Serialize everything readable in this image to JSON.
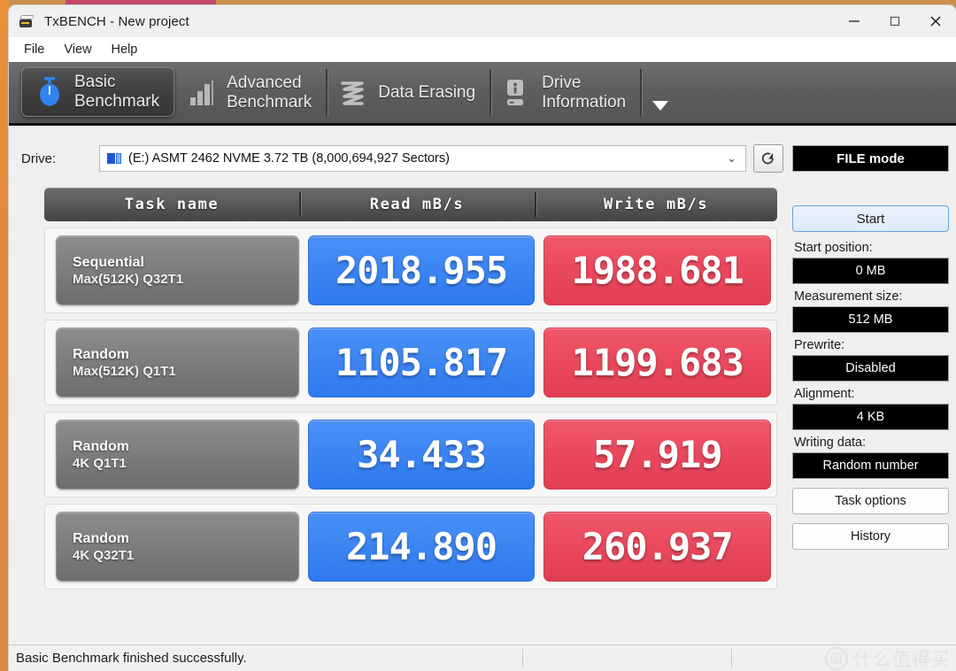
{
  "window": {
    "title": "TxBENCH - New project",
    "app_icon": "drive-icon",
    "controls": {
      "minimize": "minimize-icon",
      "maximize": "maximize-icon",
      "close": "close-icon"
    }
  },
  "menubar": {
    "items": [
      {
        "label": "File"
      },
      {
        "label": "View"
      },
      {
        "label": "Help"
      }
    ]
  },
  "tabs": {
    "items": [
      {
        "line1": "Basic",
        "line2": "Benchmark",
        "icon": "stopwatch-icon",
        "active": true
      },
      {
        "line1": "Advanced",
        "line2": "Benchmark",
        "icon": "bar-chart-icon",
        "active": false
      },
      {
        "line1": "Data Erasing",
        "line2": "",
        "icon": "shredder-icon",
        "active": false
      },
      {
        "line1": "Drive",
        "line2": "Information",
        "icon": "drive-info-icon",
        "active": false
      }
    ],
    "overflow": "chevron-down-icon"
  },
  "drive": {
    "label": "Drive:",
    "value": "(E:) ASMT 2462 NVME  3.72 TB (8,000,694,927 Sectors)",
    "dropdown_arrow": "⌄",
    "refresh_icon": "refresh-icon"
  },
  "table": {
    "headers": {
      "task": "Task name",
      "read": "Read mB/s",
      "write": "Write mB/s"
    },
    "rows": [
      {
        "task_line1": "Sequential",
        "task_line2": "Max(512K) Q32T1",
        "read": "2018.955",
        "write": "1988.681"
      },
      {
        "task_line1": "Random",
        "task_line2": "Max(512K) Q1T1",
        "read": "1105.817",
        "write": "1199.683"
      },
      {
        "task_line1": "Random",
        "task_line2": "4K Q1T1",
        "read": "34.433",
        "write": "57.919"
      },
      {
        "task_line1": "Random",
        "task_line2": "4K Q32T1",
        "read": "214.890",
        "write": "260.937"
      }
    ]
  },
  "sidebar": {
    "mode_badge": "FILE mode",
    "start_button": "Start",
    "fields": [
      {
        "label": "Start position:",
        "value": "0 MB"
      },
      {
        "label": "Measurement size:",
        "value": "512 MB"
      },
      {
        "label": "Prewrite:",
        "value": "Disabled"
      },
      {
        "label": "Alignment:",
        "value": "4 KB"
      },
      {
        "label": "Writing data:",
        "value": "Random number"
      }
    ],
    "task_options_button": "Task options",
    "history_button": "History"
  },
  "statusbar": {
    "message": "Basic Benchmark finished successfully.",
    "panel2": "",
    "panel3": "",
    "watermark_mark": "值",
    "watermark_text": "什么值得买"
  },
  "colors": {
    "read_accent": "#3d86f2",
    "write_accent": "#ea4a5e",
    "tab_active": "#3f3f3f",
    "badge_bg": "#000000"
  },
  "chart_data": {
    "type": "bar",
    "title": "TxBENCH Basic Benchmark results",
    "categories": [
      "Sequential Max(512K) Q32T1",
      "Random Max(512K) Q1T1",
      "Random 4K Q1T1",
      "Random 4K Q32T1"
    ],
    "series": [
      {
        "name": "Read mB/s",
        "values": [
          2018.955,
          1105.817,
          34.433,
          214.89
        ]
      },
      {
        "name": "Write mB/s",
        "values": [
          1988.681,
          1199.683,
          57.919,
          260.937
        ]
      }
    ],
    "xlabel": "Task name",
    "ylabel": "mB/s",
    "legend_position": "top"
  }
}
